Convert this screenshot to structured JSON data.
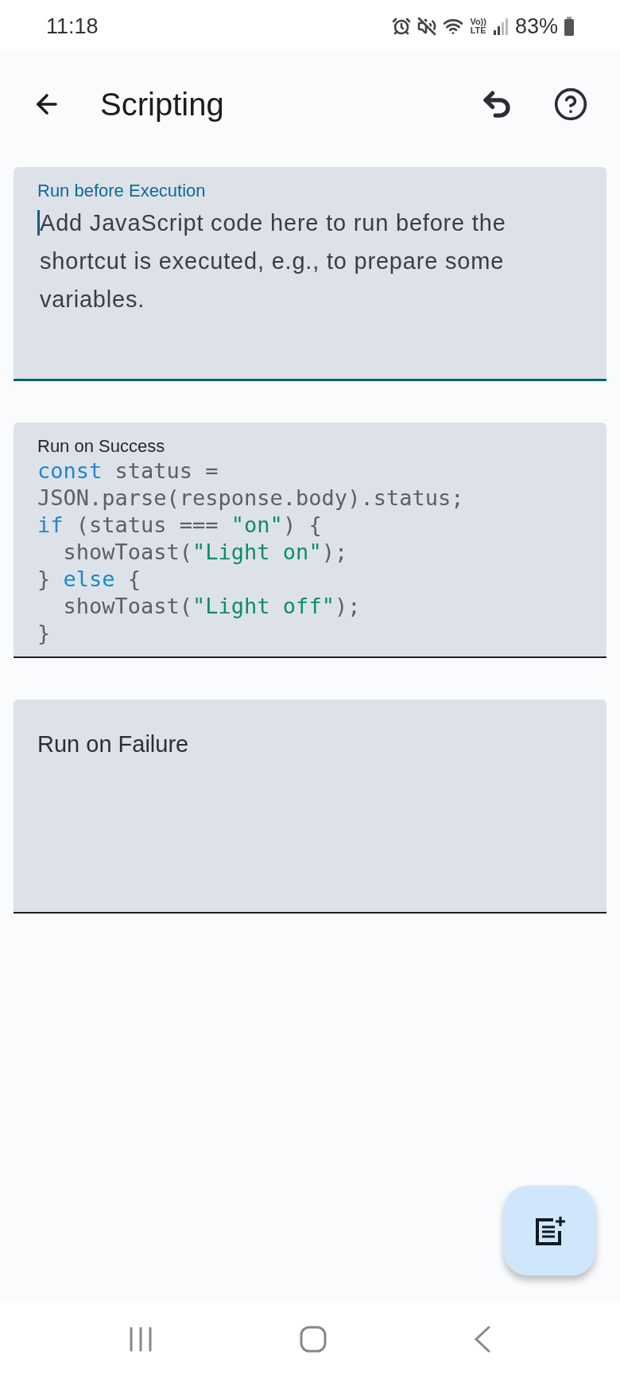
{
  "status_bar": {
    "time": "11:18",
    "volte": [
      "Vo))",
      "LTE"
    ],
    "battery": "83%"
  },
  "app_bar": {
    "title": "Scripting"
  },
  "fields": [
    {
      "label": "Run before Execution",
      "focused": true,
      "placeholder": "Add JavaScript code here to run before the shortcut is executed, e.g., to prepare some variables."
    },
    {
      "label": "Run on Success",
      "focused": false,
      "code": [
        [
          {
            "kind": "keyword",
            "text": "const"
          },
          {
            "kind": "plain",
            "text": " status ="
          }
        ],
        [
          {
            "kind": "plain",
            "text": "JSON.parse(response.body).status;"
          }
        ],
        [
          {
            "kind": "keyword",
            "text": "if"
          },
          {
            "kind": "plain",
            "text": " (status === "
          },
          {
            "kind": "string",
            "text": "\"on\""
          },
          {
            "kind": "plain",
            "text": ") {"
          }
        ],
        [
          {
            "kind": "plain",
            "text": "  showToast("
          },
          {
            "kind": "string",
            "text": "\"Light on\""
          },
          {
            "kind": "plain",
            "text": ");"
          }
        ],
        [
          {
            "kind": "plain",
            "text": "} "
          },
          {
            "kind": "keyword",
            "text": "else"
          },
          {
            "kind": "plain",
            "text": " {"
          }
        ],
        [
          {
            "kind": "plain",
            "text": "  showToast("
          },
          {
            "kind": "string",
            "text": "\"Light off\""
          },
          {
            "kind": "plain",
            "text": ");"
          }
        ],
        [
          {
            "kind": "plain",
            "text": "}"
          }
        ]
      ]
    },
    {
      "label": "Run on Failure",
      "focused": false
    }
  ]
}
